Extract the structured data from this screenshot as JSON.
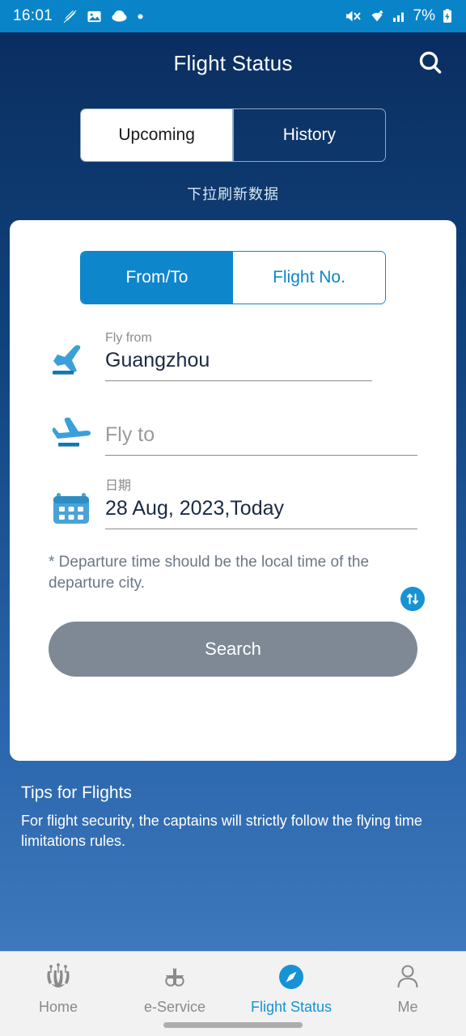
{
  "statusbar": {
    "time": "16:01",
    "battery_percent": "7%",
    "left_icons": [
      "pen-slash-icon",
      "image-icon",
      "cloud-icon",
      "dot-icon"
    ],
    "right_icons": [
      "volume-mute-icon",
      "wifi-icon",
      "signal-bars-icon",
      "battery-charging-icon"
    ]
  },
  "header": {
    "title": "Flight Status",
    "search_icon": "search-icon"
  },
  "top_tabs": {
    "items": [
      {
        "label": "Upcoming",
        "active": true
      },
      {
        "label": "History",
        "active": false
      }
    ]
  },
  "pull_hint": "下拉刷新数据",
  "card": {
    "mode_tabs": [
      {
        "label": "From/To",
        "active": true
      },
      {
        "label": "Flight No.",
        "active": false
      }
    ],
    "fields": {
      "from": {
        "label": "Fly from",
        "value": "Guangzhou",
        "icon": "plane-takeoff-icon"
      },
      "to": {
        "label": "",
        "placeholder": "Fly to",
        "value": "",
        "icon": "plane-landing-icon"
      },
      "date": {
        "label": "日期",
        "value": "28 Aug, 2023,Today",
        "icon": "calendar-icon"
      }
    },
    "swap_icon": "swap-vertical-icon",
    "note": "* Departure time should be the local time of the departure city.",
    "search_button": "Search"
  },
  "tips": {
    "title": "Tips for Flights",
    "body": "For flight security, the captains will strictly follow the flying time limitations rules."
  },
  "bottomnav": {
    "items": [
      {
        "label": "Home",
        "icon": "kapok-flower-icon",
        "active": false
      },
      {
        "label": "e-Service",
        "icon": "four-petal-icon",
        "active": false
      },
      {
        "label": "Flight Status",
        "icon": "compass-icon",
        "active": true
      },
      {
        "label": "Me",
        "icon": "person-icon",
        "active": false
      }
    ]
  },
  "colors": {
    "status_bar": "#0a84c8",
    "bg_top": "#0a2a5e",
    "bg_bottom": "#3f79bd",
    "accent": "#0e86cb",
    "disabled_button": "#7e8995",
    "active_nav": "#1693d4"
  }
}
